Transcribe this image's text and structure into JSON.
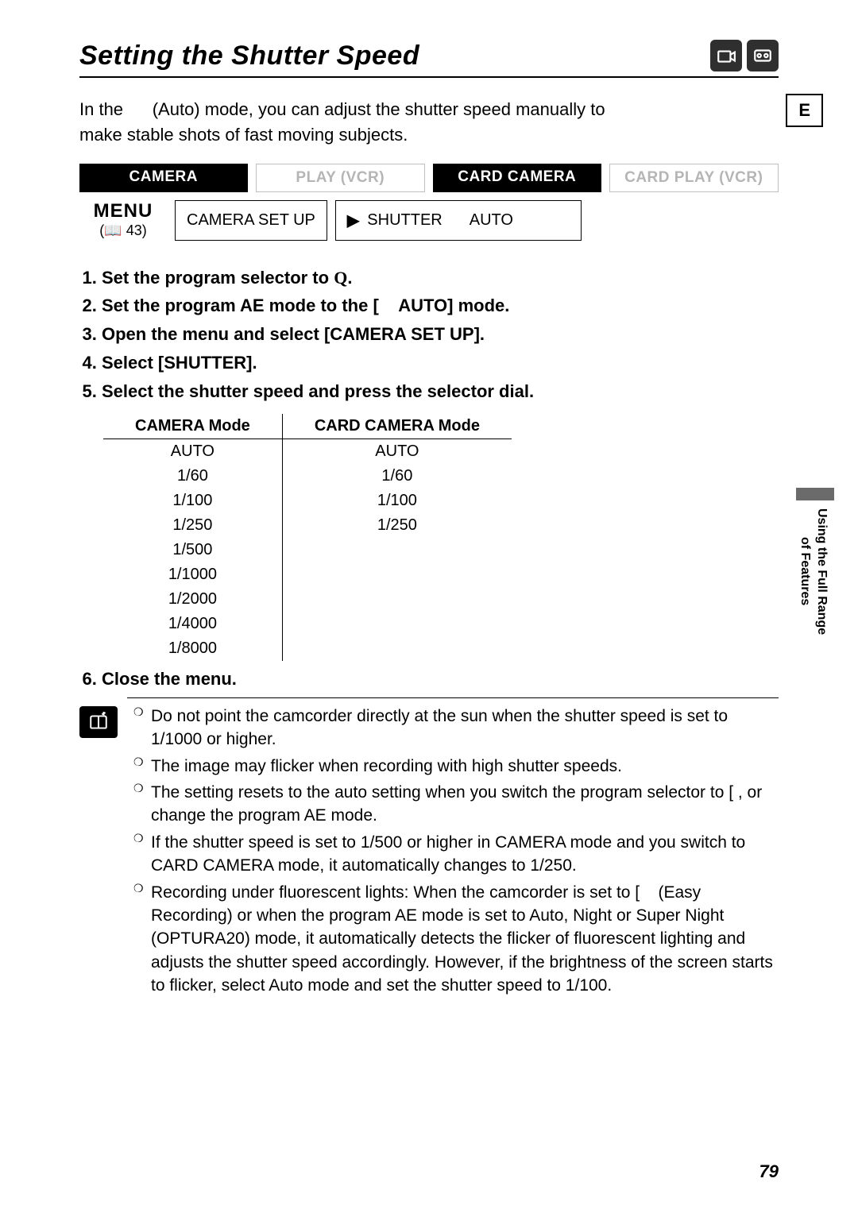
{
  "title": "Setting the Shutter Speed",
  "header_icons": [
    "camera-body-icon",
    "tape-icon"
  ],
  "language_tab": "E",
  "intro": "In the      (Auto) mode, you can adjust the shutter speed manually to make stable shots of fast moving subjects.",
  "modes": [
    {
      "label": "CAMERA",
      "active": true
    },
    {
      "label": "PLAY (VCR)",
      "active": false
    },
    {
      "label": "CARD CAMERA",
      "active": true
    },
    {
      "label": "CARD PLAY (VCR)",
      "active": false
    }
  ],
  "menu": {
    "word": "MENU",
    "ref": "(📖 43)",
    "box1": "CAMERA SET UP",
    "box2_label": "SHUTTER",
    "box2_value": "AUTO"
  },
  "steps": [
    "Set the program selector to Q.",
    "Set the program AE mode to the [    AUTO] mode.",
    "Open the menu and select [CAMERA SET UP].",
    "Select [SHUTTER].",
    "Select the shutter speed and press the selector dial.",
    "Close the menu."
  ],
  "shutter_table": {
    "headers": [
      "CAMERA Mode",
      "CARD CAMERA Mode"
    ],
    "rows": [
      [
        "AUTO",
        "AUTO"
      ],
      [
        "1/60",
        "1/60"
      ],
      [
        "1/100",
        "1/100"
      ],
      [
        "1/250",
        "1/250"
      ],
      [
        "1/500",
        ""
      ],
      [
        "1/1000",
        ""
      ],
      [
        "1/2000",
        ""
      ],
      [
        "1/4000",
        ""
      ],
      [
        "1/8000",
        ""
      ]
    ]
  },
  "notes": [
    "Do not point the camcorder directly at the sun when the shutter speed is set to 1/1000 or higher.",
    "The image may flicker when recording with high shutter speeds.",
    "The setting resets to the auto setting when you switch the program selector to [ , or change the program AE mode.",
    "If the shutter speed is set to 1/500 or higher in CAMERA mode and you switch to CARD CAMERA mode, it automatically changes to 1/250.",
    "Recording under fluorescent lights: When the camcorder is set to [    (Easy Recording) or when the program AE mode is set to Auto, Night or Super Night (OPTURA20) mode, it automatically detects the flicker of fluorescent lighting and adjusts the shutter speed accordingly. However, if the brightness of the screen starts to flicker, select Auto mode and set the shutter speed to 1/100."
  ],
  "side_tab": "Using the Full Range\nof Features",
  "page_number": "79"
}
